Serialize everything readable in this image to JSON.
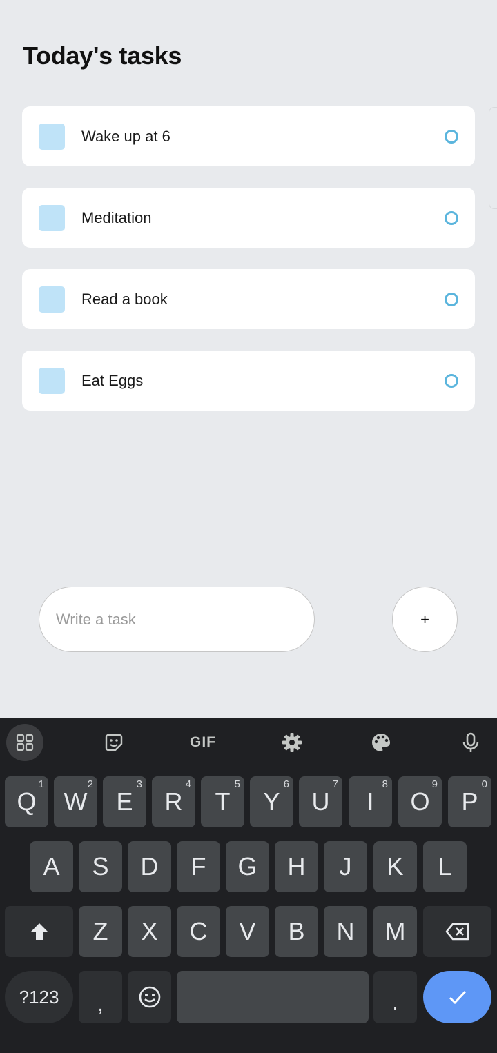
{
  "header": {
    "title": "Today's tasks"
  },
  "tasks": [
    {
      "label": "Wake up at 6"
    },
    {
      "label": "Meditation"
    },
    {
      "label": "Read a book"
    },
    {
      "label": "Eat Eggs"
    }
  ],
  "composer": {
    "placeholder": "Write a task",
    "add_label": "+"
  },
  "keyboard": {
    "toolbar": {
      "gif_label": "GIF"
    },
    "row1": [
      {
        "key": "Q",
        "hint": "1"
      },
      {
        "key": "W",
        "hint": "2"
      },
      {
        "key": "E",
        "hint": "3"
      },
      {
        "key": "R",
        "hint": "4"
      },
      {
        "key": "T",
        "hint": "5"
      },
      {
        "key": "Y",
        "hint": "6"
      },
      {
        "key": "U",
        "hint": "7"
      },
      {
        "key": "I",
        "hint": "8"
      },
      {
        "key": "O",
        "hint": "9"
      },
      {
        "key": "P",
        "hint": "0"
      }
    ],
    "row2": [
      "A",
      "S",
      "D",
      "F",
      "G",
      "H",
      "J",
      "K",
      "L"
    ],
    "row3": [
      "Z",
      "X",
      "C",
      "V",
      "B",
      "N",
      "M"
    ],
    "symbols_label": "?123",
    "comma_label": ",",
    "period_label": ".",
    "colors": {
      "enter": "#5e97f6",
      "key_bg": "#44474a",
      "keyboard_bg": "#1f2023"
    }
  },
  "colors": {
    "background": "#e8eaed",
    "task_square": "#bfe3f8",
    "task_circle": "#5bb5dd"
  }
}
